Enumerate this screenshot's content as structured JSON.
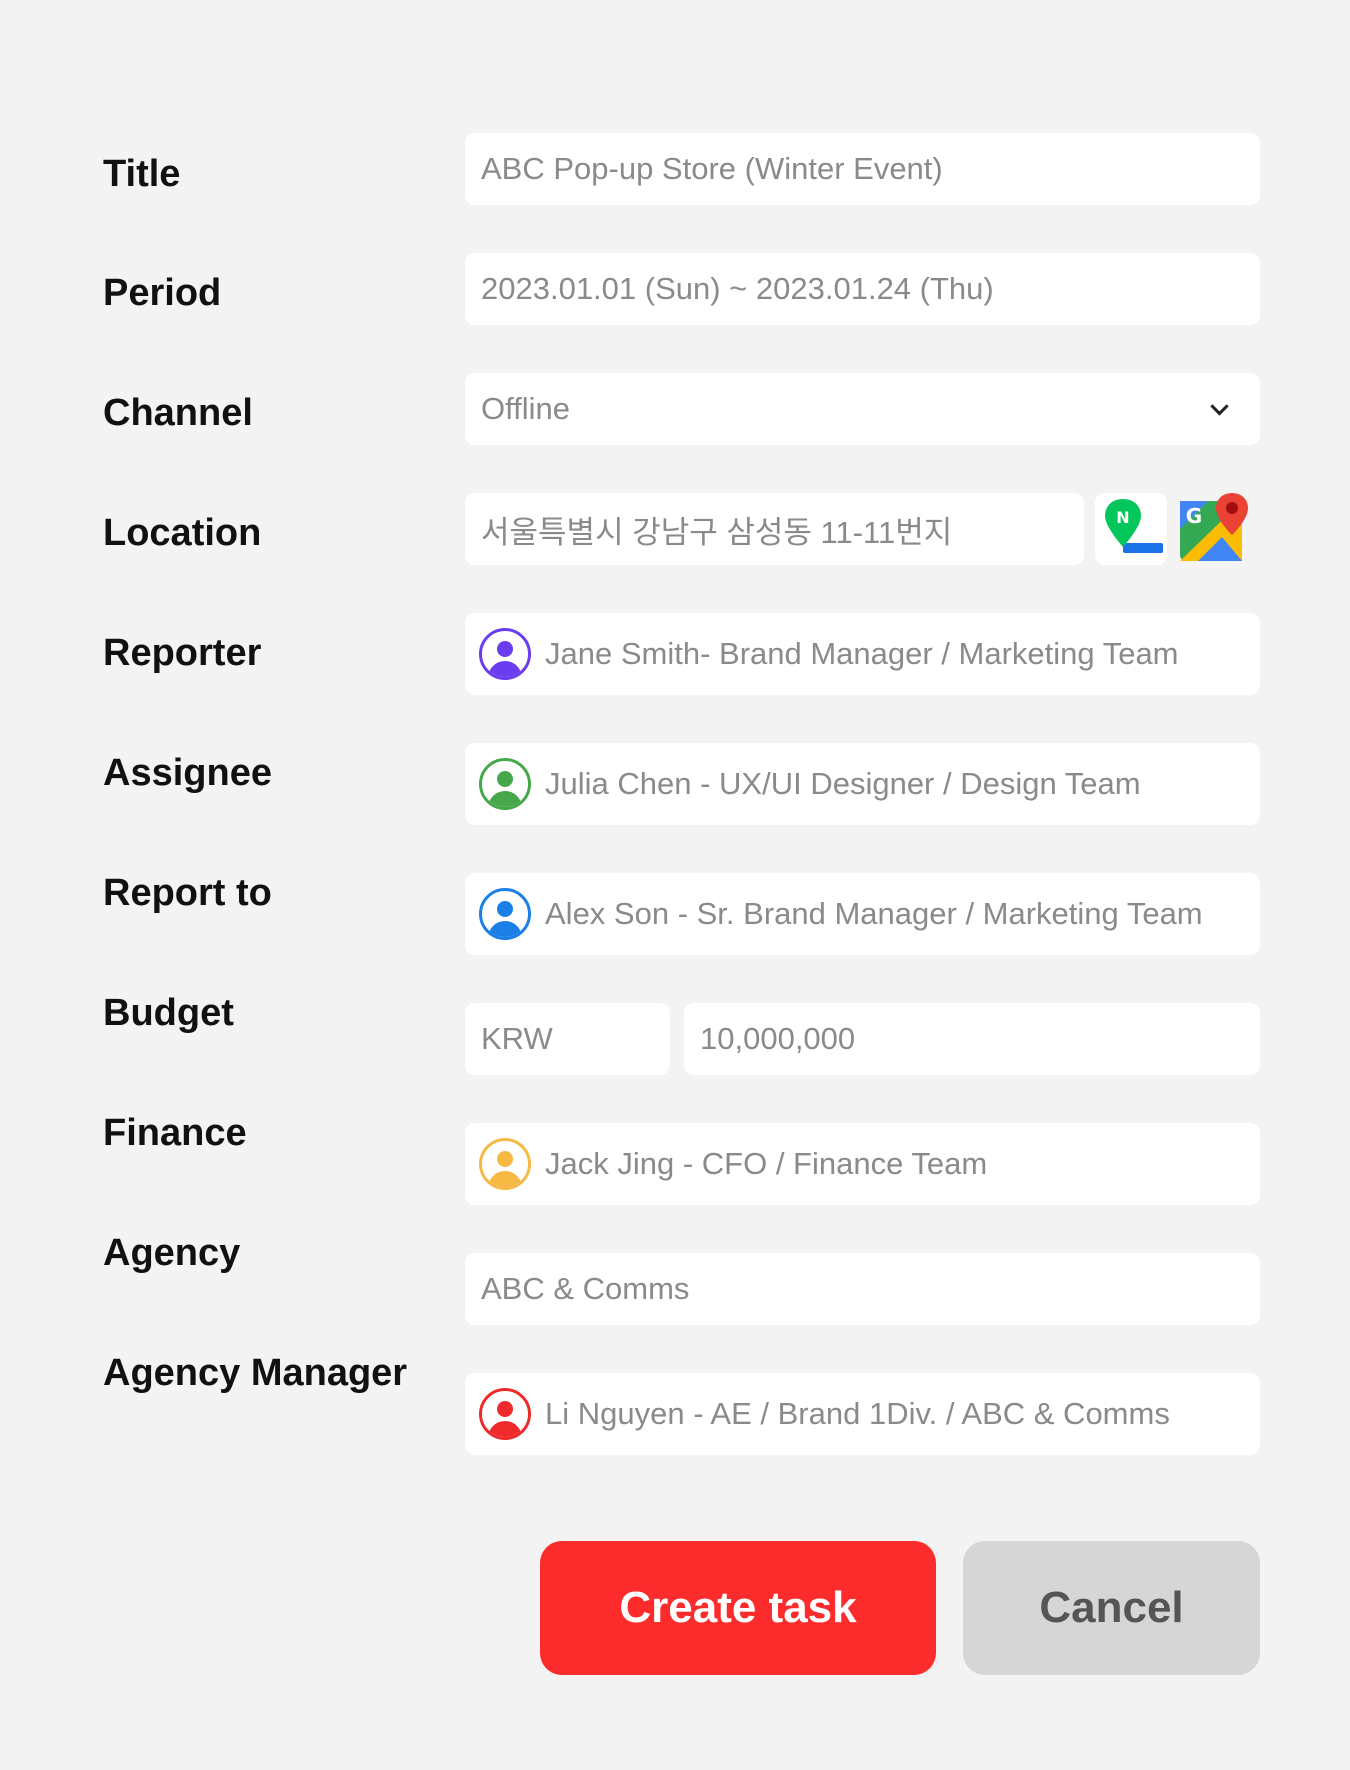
{
  "form": {
    "title": {
      "label": "Title",
      "value": "ABC Pop-up Store (Winter Event)"
    },
    "period": {
      "label": "Period",
      "value": "2023.01.01 (Sun) ~ 2023.01.24 (Thu)"
    },
    "channel": {
      "label": "Channel",
      "value": "Offline",
      "icon": "chevron-down-icon"
    },
    "location": {
      "label": "Location",
      "value": "서울특별시 강남구 삼성동 11-11번지",
      "naver_map_icon": "naver-map-icon",
      "google_map_icon": "google-maps-icon"
    },
    "reporter": {
      "label": "Reporter",
      "value": "Jane Smith- Brand Manager / Marketing Team",
      "avatar_color": "#6a3df0"
    },
    "assignee": {
      "label": "Assignee",
      "value": "Julia Chen - UX/UI Designer / Design Team",
      "avatar_color": "#47a84b"
    },
    "report_to": {
      "label": "Report to",
      "value": "Alex Son - Sr. Brand Manager / Marketing Team",
      "avatar_color": "#1b7fe8"
    },
    "budget": {
      "label": "Budget",
      "currency": "KRW",
      "amount": "10,000,000"
    },
    "finance": {
      "label": "Finance",
      "value": "Jack Jing - CFO / Finance Team",
      "avatar_color": "#f5b944"
    },
    "agency": {
      "label": "Agency",
      "value": "ABC & Comms"
    },
    "agency_manager": {
      "label": "Agency Manager",
      "value": "Li Nguyen - AE / Brand 1Div. / ABC & Comms",
      "avatar_color": "#ee2a2a"
    }
  },
  "actions": {
    "create_label": "Create task",
    "cancel_label": "Cancel",
    "create_color": "#fd2c2c",
    "cancel_color": "#d6d6d6"
  }
}
